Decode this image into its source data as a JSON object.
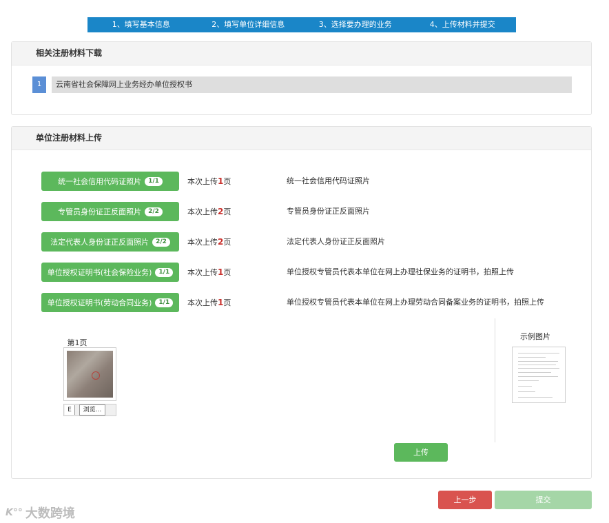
{
  "steps": [
    {
      "label": "1、填写基本信息"
    },
    {
      "label": "2、填写单位详细信息"
    },
    {
      "label": "3、选择要办理的业务"
    },
    {
      "label": "4、上传材料并提交"
    }
  ],
  "download_panel": {
    "title": "相关注册材料下载",
    "items": [
      {
        "index": "1",
        "name": "云南省社会保障网上业务经办单位授权书"
      }
    ]
  },
  "upload_panel": {
    "title": "单位注册材料上传",
    "materials": [
      {
        "label": "统一社会信用代码证照片",
        "badge": "1/1",
        "count_prefix": "本次上传",
        "count": "1",
        "count_suffix": "页",
        "desc": "统一社会信用代码证照片"
      },
      {
        "label": "专管员身份证正反面照片",
        "badge": "2/2",
        "count_prefix": "本次上传",
        "count": "2",
        "count_suffix": "页",
        "desc": "专管员身份证正反面照片"
      },
      {
        "label": "法定代表人身份证正反面照片",
        "badge": "2/2",
        "count_prefix": "本次上传",
        "count": "2",
        "count_suffix": "页",
        "desc": "法定代表人身份证正反面照片"
      },
      {
        "label": "单位授权证明书(社会保险业务)",
        "badge": "1/1",
        "count_prefix": "本次上传",
        "count": "1",
        "count_suffix": "页",
        "desc": "单位授权专管员代表本单位在网上办理社保业务的证明书，拍照上传"
      },
      {
        "label": "单位授权证明书(劳动合同业务)",
        "badge": "1/1",
        "count_prefix": "本次上传",
        "count": "1",
        "count_suffix": "页",
        "desc": "单位授权专管员代表本单位在网上办理劳动合同备案业务的证明书，拍照上传"
      }
    ],
    "page_label": "第1页",
    "file_input_value": "E",
    "browse_label": "浏览...",
    "example_label": "示例图片",
    "upload_label": "上传"
  },
  "footer": {
    "prev_label": "上一步",
    "submit_label": "提交"
  },
  "watermark": {
    "logo": "K°°",
    "text": "大数跨境"
  },
  "colors": {
    "step_bar": "#1a86c8",
    "primary_green": "#5cb85c",
    "danger_red": "#d9534f",
    "disabled_green": "#a5d6a7",
    "index_blue": "#5b8fd6"
  }
}
